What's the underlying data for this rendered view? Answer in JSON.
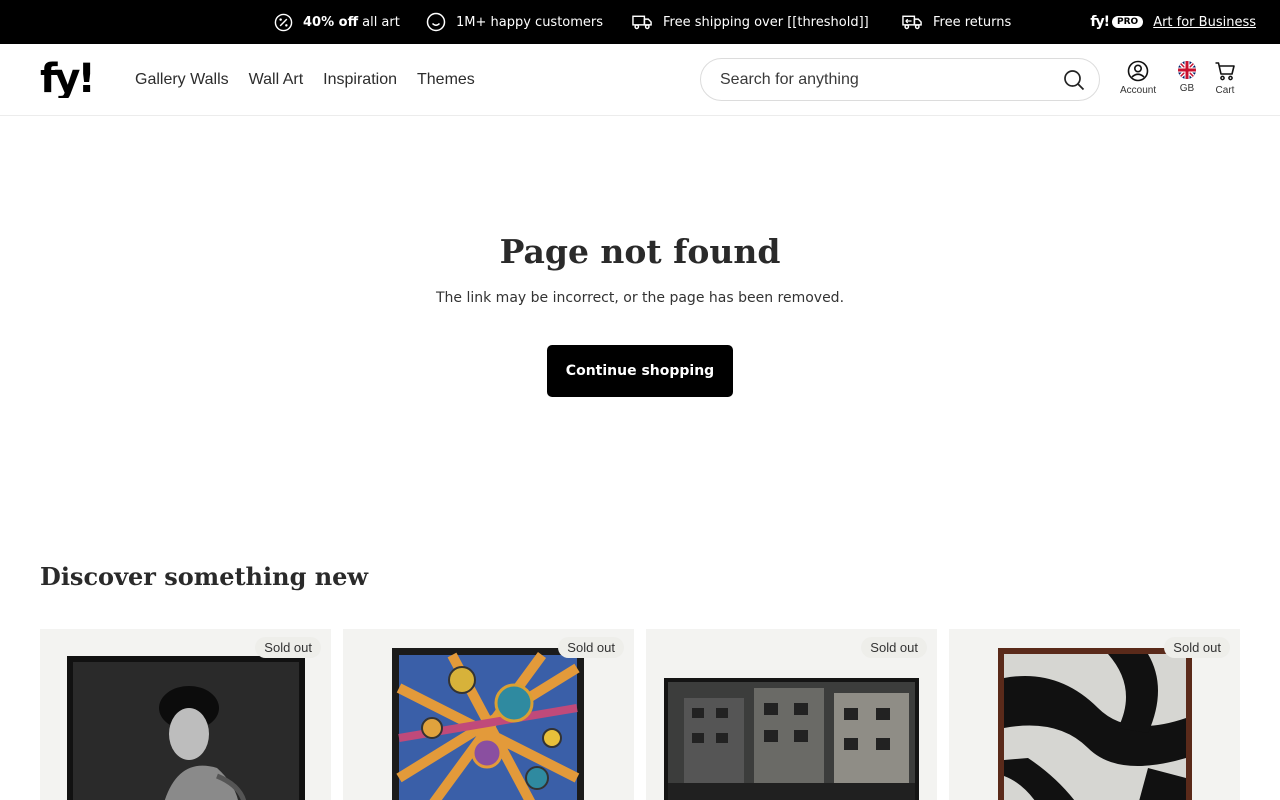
{
  "announcement": {
    "items": [
      {
        "icon": "percent-badge-icon",
        "bold": "40% off",
        "text": "all art"
      },
      {
        "icon": "smile-icon",
        "bold": "",
        "text": "1M+ happy customers"
      },
      {
        "icon": "truck-icon",
        "bold": "",
        "text": "Free shipping over [[threshold]]"
      },
      {
        "icon": "return-truck-icon",
        "bold": "",
        "text": "Free returns"
      }
    ],
    "pro_logo": "fy!",
    "pro_badge": "PRO",
    "pro_link": "Art for Business"
  },
  "header": {
    "logo_text": "fy!",
    "nav": [
      "Gallery Walls",
      "Wall Art",
      "Inspiration",
      "Themes"
    ],
    "search_placeholder": "Search for anything",
    "account_label": "Account",
    "region_label": "GB",
    "cart_label": "Cart"
  },
  "main": {
    "title": "Page not found",
    "subtitle": "The link may be incorrect, or the page has been removed.",
    "button": "Continue shopping"
  },
  "discover": {
    "title": "Discover something new",
    "products": [
      {
        "badge": "Sold out"
      },
      {
        "badge": "Sold out"
      },
      {
        "badge": "Sold out"
      },
      {
        "badge": "Sold out"
      }
    ]
  },
  "colors": {
    "black": "#000000",
    "card_bg": "#f3f3f1",
    "border": "#dcdcdc"
  }
}
